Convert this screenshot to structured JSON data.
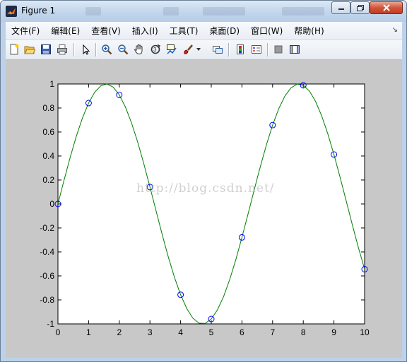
{
  "window": {
    "title": "Figure 1"
  },
  "menubar": {
    "items": [
      "文件(F)",
      "编辑(E)",
      "查看(V)",
      "插入(I)",
      "工具(T)",
      "桌面(D)",
      "窗口(W)",
      "帮助(H)"
    ]
  },
  "toolbar": {
    "icons": [
      "new-figure-icon",
      "open-file-icon",
      "save-icon",
      "print-icon",
      "select-arrow-icon",
      "zoom-in-icon",
      "zoom-out-icon",
      "pan-hand-icon",
      "rotate-3d-icon",
      "data-cursor-icon",
      "brush-icon",
      "brush-dropdown-icon",
      "link-plot-icon",
      "colorbar-icon",
      "legend-icon",
      "hide-plot-tools-icon",
      "show-plot-tools-icon"
    ]
  },
  "watermark": "http://blog.csdn.net/",
  "colors": {
    "curve": "#007f00",
    "markers": "#0000ff",
    "figure_bg": "#c8c8c8",
    "axes_bg": "#ffffff"
  },
  "chart_data": {
    "type": "line",
    "title": "",
    "xlabel": "",
    "ylabel": "",
    "xlim": [
      0,
      10
    ],
    "ylim": [
      -1,
      1
    ],
    "xticks": [
      "0",
      "1",
      "2",
      "3",
      "4",
      "5",
      "6",
      "7",
      "8",
      "9",
      "10"
    ],
    "yticks": [
      "-1",
      "-0.8",
      "-0.6",
      "-0.4",
      "-0.2",
      "0",
      "0.2",
      "0.4",
      "0.6",
      "0.8",
      "1"
    ],
    "grid": false,
    "series": [
      {
        "kind": "line",
        "style": "solid green smooth curve",
        "x": [
          0,
          0.2,
          0.4,
          0.6,
          0.8,
          1.0,
          1.2,
          1.4,
          1.6,
          1.8,
          2.0,
          2.2,
          2.4,
          2.6,
          2.8,
          3.0,
          3.2,
          3.4,
          3.6,
          3.8,
          4.0,
          4.2,
          4.4,
          4.6,
          4.8,
          5.0,
          5.2,
          5.4,
          5.6,
          5.8,
          6.0,
          6.2,
          6.4,
          6.6,
          6.8,
          7.0,
          7.2,
          7.4,
          7.6,
          7.8,
          8.0,
          8.2,
          8.4,
          8.6,
          8.8,
          9.0,
          9.2,
          9.4,
          9.6,
          9.8,
          10.0
        ],
        "y": [
          0,
          0.199,
          0.389,
          0.565,
          0.717,
          0.841,
          0.932,
          0.985,
          1.0,
          0.974,
          0.909,
          0.808,
          0.675,
          0.516,
          0.335,
          0.141,
          -0.058,
          -0.256,
          -0.443,
          -0.612,
          -0.757,
          -0.872,
          -0.952,
          -0.994,
          -0.996,
          -0.959,
          -0.883,
          -0.773,
          -0.631,
          -0.465,
          -0.279,
          -0.083,
          0.117,
          0.312,
          0.494,
          0.657,
          0.794,
          0.899,
          0.968,
          0.999,
          0.989,
          0.941,
          0.855,
          0.734,
          0.585,
          0.412,
          0.223,
          0.025,
          -0.174,
          -0.366,
          -0.544
        ]
      },
      {
        "kind": "scatter",
        "style": "blue open circles",
        "x": [
          0,
          1,
          2,
          3,
          4,
          5,
          6,
          7,
          8,
          9,
          10
        ],
        "y": [
          0,
          0.841,
          0.909,
          0.141,
          -0.757,
          -0.959,
          -0.279,
          0.657,
          0.989,
          0.412,
          -0.544
        ]
      }
    ]
  }
}
